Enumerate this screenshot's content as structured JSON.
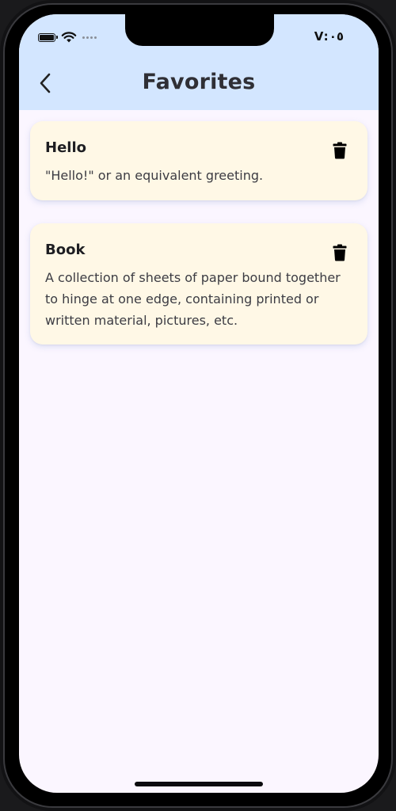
{
  "status_bar": {
    "time": "V:٠٥",
    "battery_icon": "battery-icon",
    "wifi_icon": "wifi-icon",
    "signal_icon": "cellular-dots-icon"
  },
  "header": {
    "title": "Favorites",
    "back_icon": "chevron-left-icon",
    "background": "#d3e6ff"
  },
  "favorites": [
    {
      "word": "Hello",
      "definition": "\"Hello!\" or an equivalent greeting.",
      "delete_icon": "trash-icon"
    },
    {
      "word": "Book",
      "definition": "A collection of sheets of paper bound together to hinge at one edge, containing printed or written material, pictures, etc.",
      "delete_icon": "trash-icon"
    }
  ],
  "colors": {
    "screen_background": "#fbf6ff",
    "card_background": "#fff8e6",
    "title_text": "#2f2f35"
  }
}
